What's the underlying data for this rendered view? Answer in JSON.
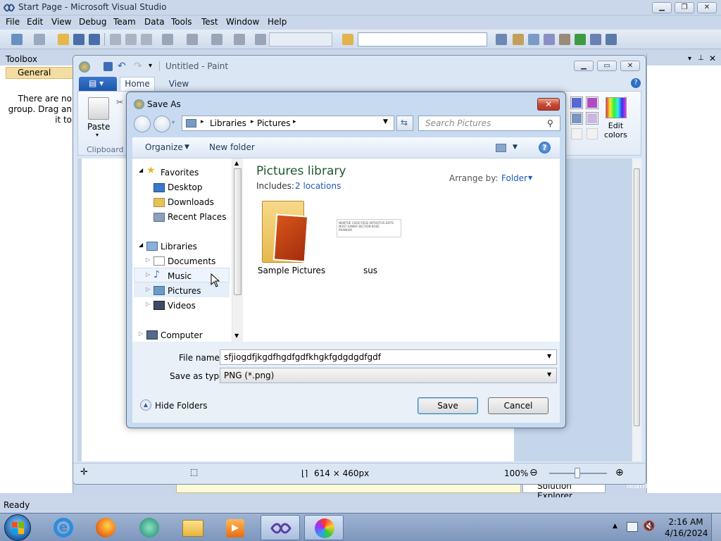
{
  "vs": {
    "title": "Start Page - Microsoft Visual Studio",
    "menu": [
      "File",
      "Edit",
      "View",
      "Debug",
      "Team",
      "Data",
      "Tools",
      "Test",
      "Window",
      "Help"
    ],
    "toolbox": {
      "title": "Toolbox",
      "group": "General",
      "message": "There are no\ngroup. Drag an\nit to"
    },
    "bottom_tabs": [
      "Solution Explorer",
      "Team Explorer"
    ],
    "status": "Ready"
  },
  "paint": {
    "title": "Untitled - Paint",
    "tabs": [
      "Home",
      "View"
    ],
    "ribbon": {
      "paste": "Paste",
      "clipboard": "Clipboard",
      "edit_colors": "Edit\ncolors"
    },
    "status": {
      "size": "614 × 460px",
      "zoom": "100%"
    }
  },
  "dialog": {
    "title": "Save As",
    "address": [
      "Libraries",
      "Pictures"
    ],
    "search_placeholder": "Search Pictures",
    "organize": "Organize",
    "new_folder": "New folder",
    "nav": {
      "favorites": "Favorites",
      "fav_items": [
        "Desktop",
        "Downloads",
        "Recent Places"
      ],
      "libraries": "Libraries",
      "lib_items": [
        "Documents",
        "Music",
        "Pictures",
        "Videos"
      ],
      "computer": "Computer"
    },
    "library_title": "Pictures library",
    "includes_label": "Includes:",
    "includes_link": "2 locations",
    "arrange_label": "Arrange by:",
    "arrange_value": "Folder",
    "items": [
      "Sample Pictures",
      "sus"
    ],
    "thumb_text": "NEWTHE CHOO RESE WITHOTUS DOTS\nMUST SAMER SECTION BOSE\nPHANIUM",
    "file_name_label": "File name:",
    "file_name": "sfjiogdfjkgdfhgdfgdfkhgkfgdgdgdfgdf",
    "type_label": "Save as type:",
    "type_value": "PNG (*.png)",
    "hide_folders": "Hide Folders",
    "save": "Save",
    "cancel": "Cancel"
  },
  "taskbar": {
    "time": "2:16 AM",
    "date": "4/16/2024"
  }
}
